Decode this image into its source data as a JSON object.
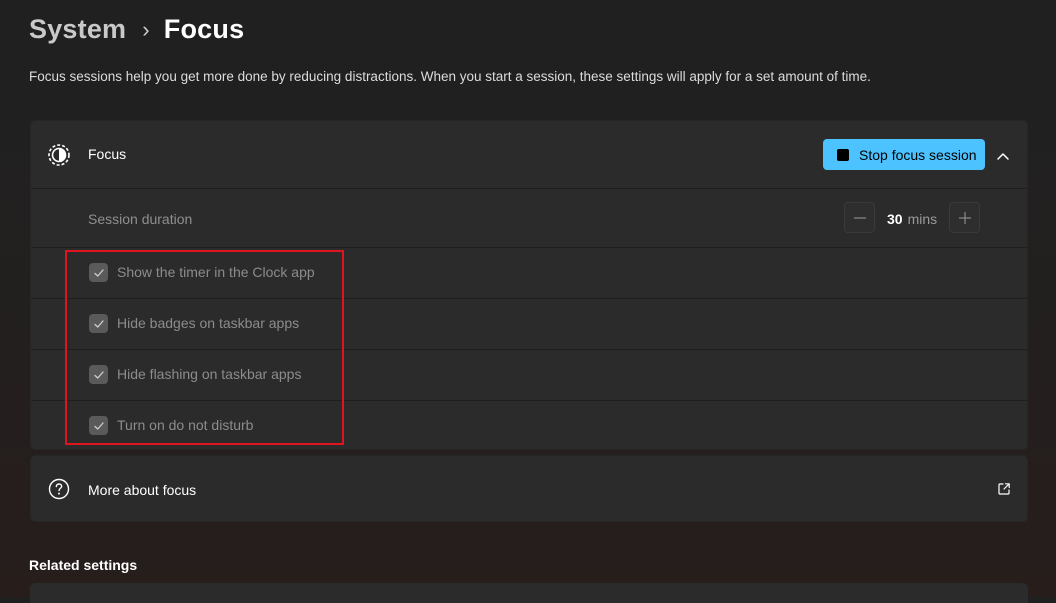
{
  "breadcrumb": {
    "parent": "System",
    "separator": "›",
    "current": "Focus"
  },
  "description": "Focus sessions help you get more done by reducing distractions. When you start a session, these settings will apply for a set amount of time.",
  "focus_card": {
    "icon": "focus-icon",
    "title": "Focus",
    "stop_button_label": "Stop focus session",
    "expanded": true,
    "session_duration": {
      "label": "Session duration",
      "value": "30",
      "unit": "mins"
    },
    "options": [
      {
        "label": "Show the timer in the Clock app",
        "checked": true
      },
      {
        "label": "Hide badges on taskbar apps",
        "checked": true
      },
      {
        "label": "Hide flashing on taskbar apps",
        "checked": true
      },
      {
        "label": "Turn on do not disturb",
        "checked": true
      }
    ]
  },
  "more_card": {
    "icon": "help-icon",
    "title": "More about focus",
    "action_icon": "external-link-icon"
  },
  "related_settings": "Related settings",
  "colors": {
    "accent": "#4cc2ff",
    "highlight": "#e0141e",
    "card": "#2b2b2b"
  }
}
